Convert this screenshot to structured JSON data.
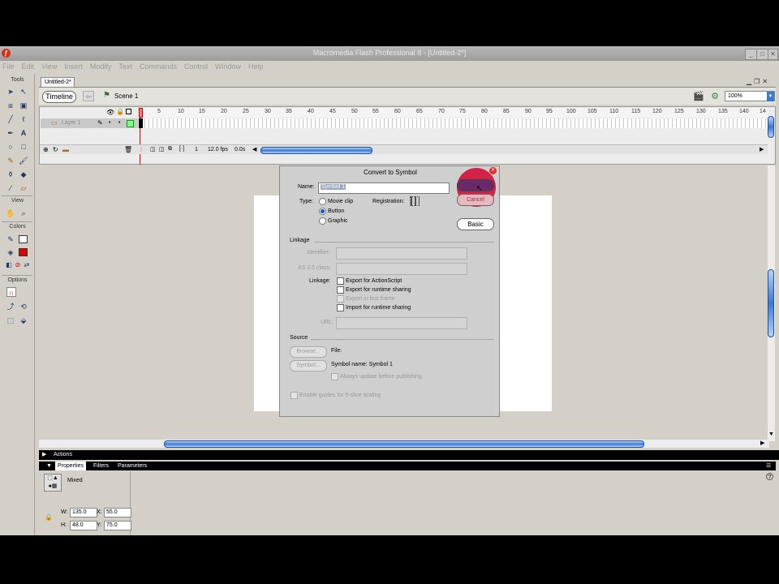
{
  "window": {
    "title": "Macromedia Flash Professional 8 - [Untitled-2*]"
  },
  "menu": [
    "File",
    "Edit",
    "View",
    "Insert",
    "Modify",
    "Text",
    "Commands",
    "Control",
    "Window",
    "Help"
  ],
  "toolbox": {
    "tools_label": "Tools",
    "view_label": "View",
    "colors_label": "Colors",
    "options_label": "Options"
  },
  "document": {
    "tab": "Untitled-2*"
  },
  "editbar": {
    "timeline_button": "Timeline",
    "scene": "Scene 1",
    "zoom": "100%"
  },
  "timeline": {
    "layer_name": "Layer 1",
    "ruler": [
      "1",
      "5",
      "10",
      "15",
      "20",
      "25",
      "30",
      "35",
      "40",
      "45",
      "50",
      "55",
      "60",
      "65",
      "70",
      "75",
      "80",
      "85",
      "90",
      "95",
      "100",
      "105",
      "110",
      "115",
      "120",
      "125",
      "130",
      "135",
      "140",
      "14"
    ],
    "frame": "1",
    "fps": "12.0 fps",
    "time": "0.0s"
  },
  "dialog": {
    "title": "Convert to Symbol",
    "name_label": "Name:",
    "name_value": "Symbol 1",
    "type_label": "Type:",
    "types": [
      "Movie clip",
      "Button",
      "Graphic"
    ],
    "selected_type": 1,
    "registration_label": "Registration:",
    "ok_label": "OK",
    "cancel_label": "Cancel",
    "basic_label": "Basic",
    "linkage_header": "Linkage",
    "identifier_label": "Identifier:",
    "as_class_label": "AS 2.0 class:",
    "linkage_label": "Linkage:",
    "linkage_options": [
      "Export for ActionScript",
      "Export for runtime sharing",
      "Export in first frame",
      "Import for runtime sharing"
    ],
    "url_label": "URL:",
    "source_header": "Source",
    "browse_label": "Browse...",
    "file_label": "File:",
    "symbol_button": "Symbol...",
    "symbol_name": "Symbol name: Symbol 1",
    "always_update": "Always update before publishing",
    "enable_guides": "Enable guides for 9-slice scaling"
  },
  "panels": {
    "actions": "Actions",
    "tabs": [
      "Properties",
      "Filters",
      "Parameters"
    ],
    "selection": "Mixed",
    "w_label": "W:",
    "w_value": "135.0",
    "x_label": "X:",
    "x_value": "55.0",
    "h_label": "H:",
    "h_value": "48.0",
    "y_label": "Y:",
    "y_value": "75.0"
  },
  "colors": {
    "highlight": "#d4143c",
    "scrollbar": "#3a78d4"
  }
}
